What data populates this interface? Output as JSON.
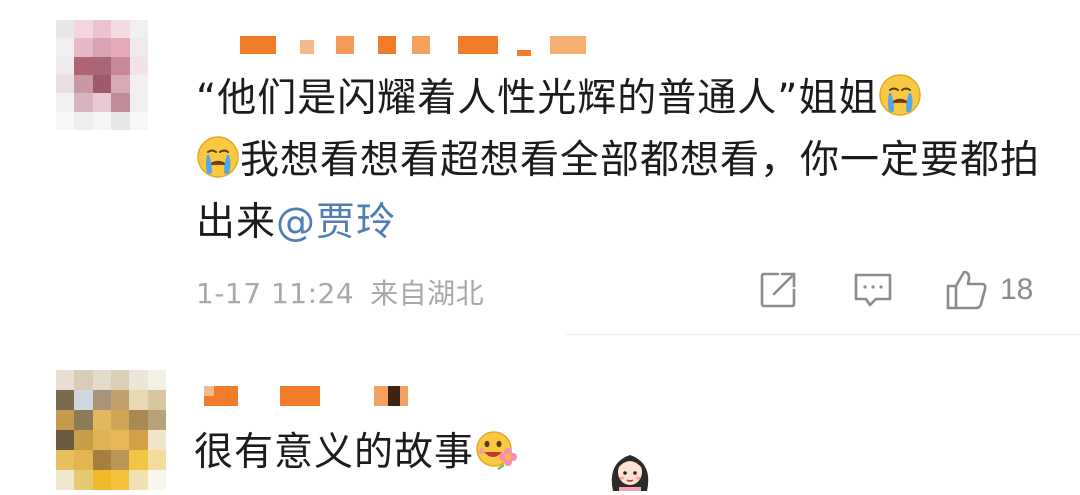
{
  "comment1": {
    "avatar_pixels": [
      "#e9e7e9",
      "#f3d6df",
      "#ecc2cf",
      "#f4dce3",
      "#f0eef0",
      "#f1eef0",
      "#e7b8c5",
      "#d8a3b3",
      "#e6a9ba",
      "#eeeaec",
      "#eeeaec",
      "#b06473",
      "#a96676",
      "#c88a9a",
      "#f1e4e8",
      "#ecdfe3",
      "#ca98a5",
      "#a0596c",
      "#d7aab7",
      "#f3eef0",
      "#f3f2f3",
      "#d9b3bd",
      "#e6c9d1",
      "#c28d9b",
      "#f0eef0",
      "#f7f7f7",
      "#eeeeee",
      "#f5f5f5",
      "#e8e8e8",
      "#f7f7f7"
    ],
    "username_colors": [
      "#f07c2a",
      "#f3a66a",
      "#f6b98a",
      "#f4a15e"
    ],
    "text_before_emoji": "“他们是闪耀着人性光辉的普通人”姐姐",
    "text_after_emoji": "我想看想看超想看全部都想看，你一定要都拍出来",
    "mention": "@贾玲",
    "time": "1-17 11:24",
    "location": "来自湖北",
    "like_count": "18",
    "icons": [
      "share-icon",
      "comment-icon",
      "like-icon",
      "crying-emoji-icon"
    ]
  },
  "comment2": {
    "avatar_pixels": [
      "#e9ded1",
      "#d9cbb8",
      "#e4dccb",
      "#dccfb8",
      "#ede6d8",
      "#f5f0e6",
      "#7a6a4f",
      "#cfd6dd",
      "#a89478",
      "#c0a06b",
      "#e8d9b5",
      "#d9c59e",
      "#c49a4d",
      "#8c7a59",
      "#e1b861",
      "#d0a655",
      "#a88b53",
      "#b8a27a",
      "#6b5a3e",
      "#c79d4a",
      "#deb353",
      "#e6b955",
      "#d3a04a",
      "#f1e6c8",
      "#e8bf5e",
      "#e1b550",
      "#a47f3d",
      "#b99654",
      "#f1c644",
      "#f3dd9c",
      "#f0e7cf",
      "#e6c86e",
      "#f1ba2a",
      "#f3c23a",
      "#efe1b3",
      "#faf6ec"
    ],
    "username_colors": [
      "#f07c2a",
      "#f6b98a",
      "#f4a15e"
    ],
    "text": "很有意义的故事",
    "icons": [
      "flower-smile-emoji-icon",
      "cartoon-girl-sticker"
    ]
  }
}
